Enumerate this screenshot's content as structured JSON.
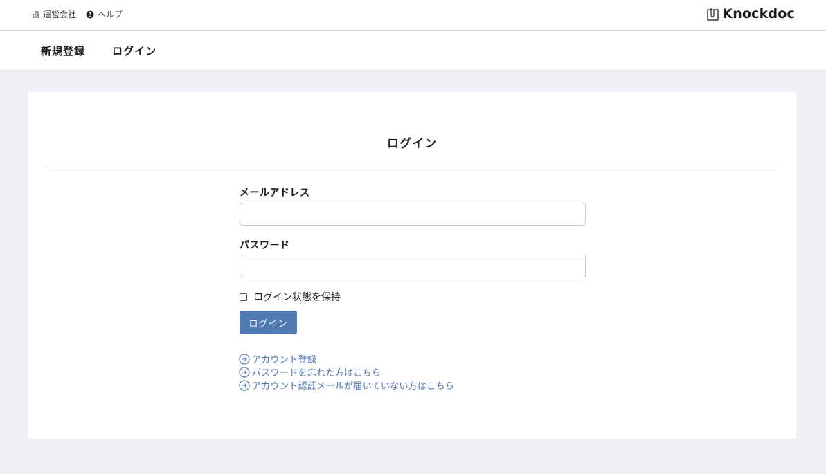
{
  "topbar": {
    "company_label": "運営会社",
    "help_label": "ヘルプ",
    "brand_name": "Knockdoc"
  },
  "nav": {
    "register_label": "新規登録",
    "login_label": "ログイン"
  },
  "form": {
    "title": "ログイン",
    "email_label": "メールアドレス",
    "email_value": "",
    "password_label": "パスワード",
    "password_value": "",
    "remember_label": "ログイン状態を保持",
    "remember_checked": false,
    "submit_label": "ログイン"
  },
  "links": [
    {
      "label": "アカウント登録",
      "icon": "arrow-circle-right-icon"
    },
    {
      "label": "パスワードを忘れた方はこちら",
      "icon": "arrow-circle-right-icon"
    },
    {
      "label": "アカウント認証メールが届いていない方はこちら",
      "icon": "arrow-circle-right-icon"
    }
  ],
  "colors": {
    "accent": "#5179b2",
    "link": "#4a73b0",
    "background": "#eff0f4"
  }
}
